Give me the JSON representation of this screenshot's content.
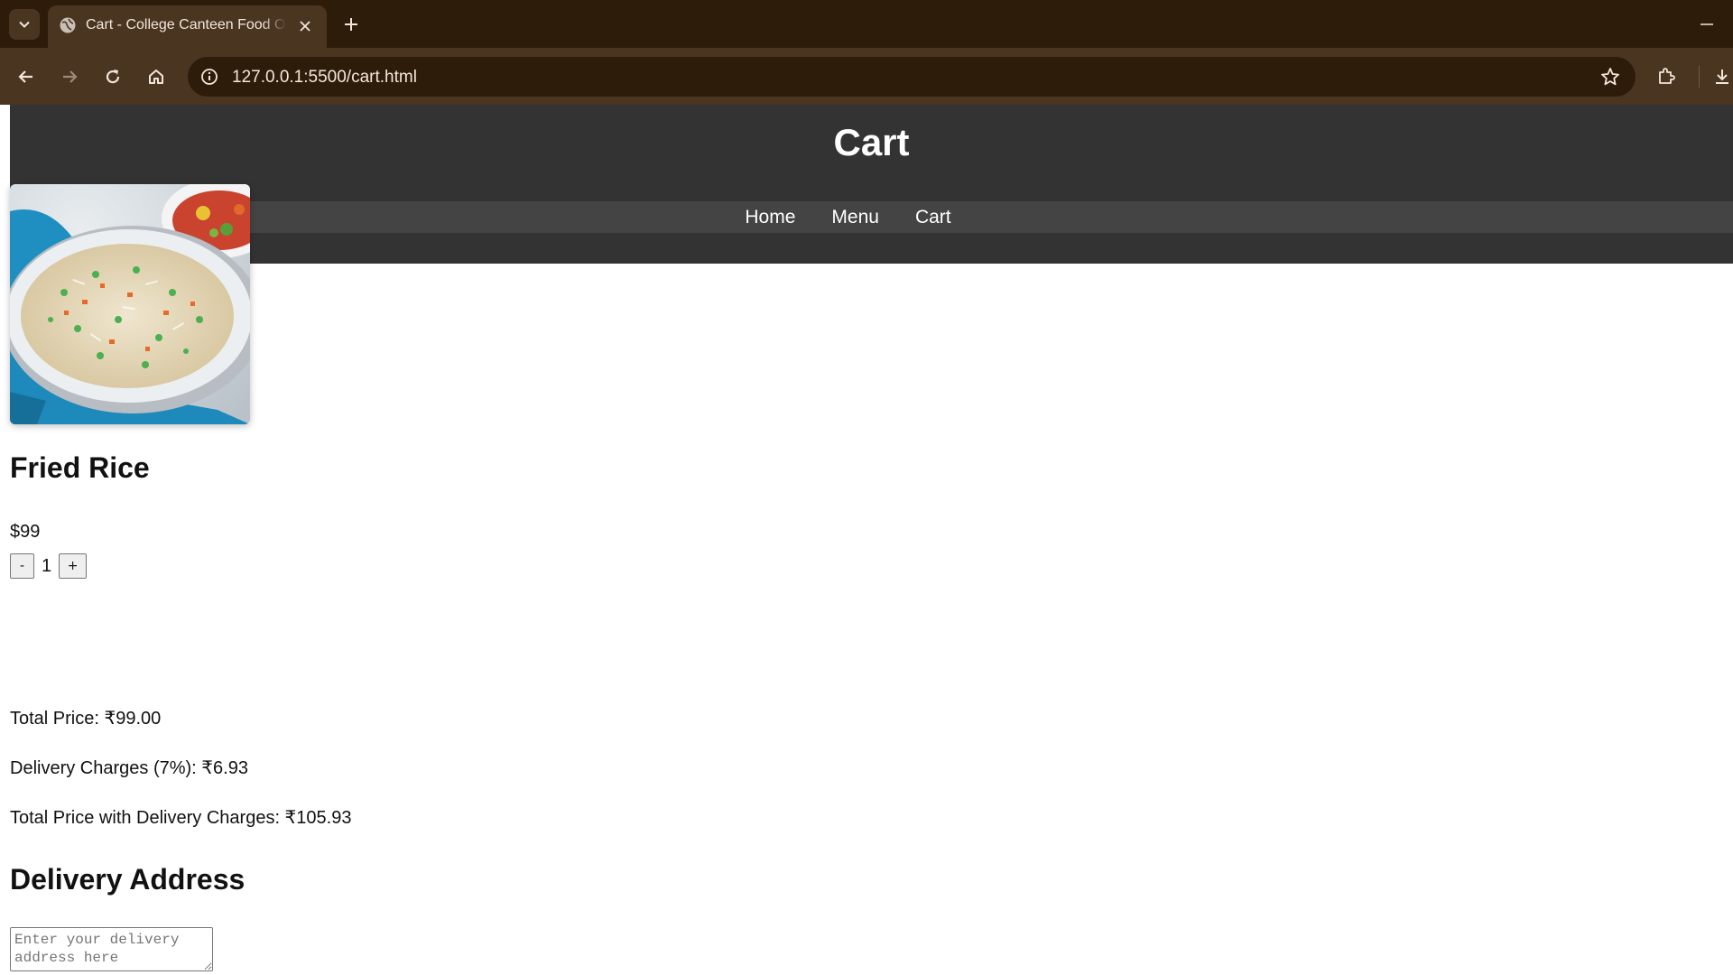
{
  "browser": {
    "tab_title": "Cart - College Canteen Food Ordering",
    "url": "127.0.0.1:5500/cart.html",
    "icons": [
      "tab-list-icon",
      "globe-icon",
      "close-icon",
      "plus-icon",
      "minimize-icon",
      "back-icon",
      "forward-icon",
      "reload-icon",
      "home-icon",
      "info-icon",
      "star-icon",
      "extensions-icon",
      "download-icon"
    ]
  },
  "header": {
    "title": "Cart",
    "nav": [
      {
        "label": "Home"
      },
      {
        "label": "Menu"
      },
      {
        "label": "Cart"
      }
    ]
  },
  "cart": {
    "item": {
      "name": "Fried Rice",
      "price": "$99",
      "image_alt": "fried-rice-photo",
      "quantity": "1",
      "minus_label": "-",
      "plus_label": "+"
    },
    "summary": {
      "total_price": "Total Price: ₹99.00",
      "delivery_charges": "Delivery Charges (7%): ₹6.93",
      "grand_total": "Total Price with Delivery Charges: ₹105.93"
    }
  },
  "delivery": {
    "heading": "Delivery Address",
    "placeholder": "Enter your delivery address here"
  },
  "colors": {
    "chrome_dark": "#2e1c0b",
    "chrome_mid": "#4a3520",
    "header_bg": "#333333",
    "nav_bg": "#444444"
  }
}
